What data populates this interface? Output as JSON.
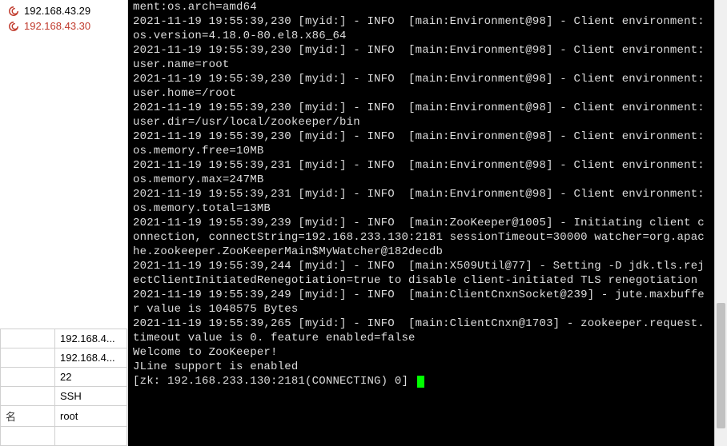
{
  "sidebar": {
    "hosts": [
      {
        "ip": "192.168.43.29",
        "selected": false
      },
      {
        "ip": "192.168.43.30",
        "selected": true
      }
    ],
    "props": [
      {
        "k": "",
        "v": "192.168.4..."
      },
      {
        "k": "",
        "v": "192.168.4..."
      },
      {
        "k": "",
        "v": "22"
      },
      {
        "k": "",
        "v": "SSH"
      },
      {
        "k": "名",
        "v": "root"
      },
      {
        "k": "",
        "v": ""
      }
    ]
  },
  "terminal": {
    "lines": [
      "ment:os.arch=amd64",
      "2021-11-19 19:55:39,230 [myid:] - INFO  [main:Environment@98] - Client environment:os.version=4.18.0-80.el8.x86_64",
      "2021-11-19 19:55:39,230 [myid:] - INFO  [main:Environment@98] - Client environment:user.name=root",
      "2021-11-19 19:55:39,230 [myid:] - INFO  [main:Environment@98] - Client environment:user.home=/root",
      "2021-11-19 19:55:39,230 [myid:] - INFO  [main:Environment@98] - Client environment:user.dir=/usr/local/zookeeper/bin",
      "2021-11-19 19:55:39,230 [myid:] - INFO  [main:Environment@98] - Client environment:os.memory.free=10MB",
      "2021-11-19 19:55:39,231 [myid:] - INFO  [main:Environment@98] - Client environment:os.memory.max=247MB",
      "2021-11-19 19:55:39,231 [myid:] - INFO  [main:Environment@98] - Client environment:os.memory.total=13MB",
      "2021-11-19 19:55:39,239 [myid:] - INFO  [main:ZooKeeper@1005] - Initiating client connection, connectString=192.168.233.130:2181 sessionTimeout=30000 watcher=org.apache.zookeeper.ZooKeeperMain$MyWatcher@182decdb",
      "2021-11-19 19:55:39,244 [myid:] - INFO  [main:X509Util@77] - Setting -D jdk.tls.rejectClientInitiatedRenegotiation=true to disable client-initiated TLS renegotiation",
      "2021-11-19 19:55:39,249 [myid:] - INFO  [main:ClientCnxnSocket@239] - jute.maxbuffer value is 1048575 Bytes",
      "2021-11-19 19:55:39,265 [myid:] - INFO  [main:ClientCnxn@1703] - zookeeper.request.timeout value is 0. feature enabled=false",
      "Welcome to ZooKeeper!",
      "JLine support is enabled"
    ],
    "prompt": "[zk: 192.168.233.130:2181(CONNECTING) 0] "
  },
  "icons": {
    "swirl": "swirl-icon"
  }
}
